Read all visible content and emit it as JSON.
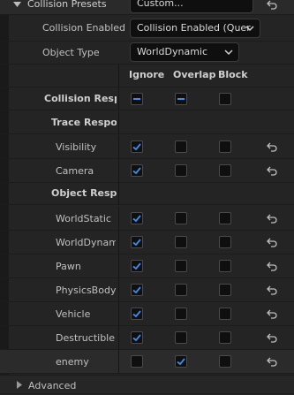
{
  "header": {
    "presets_label": "Collision Presets",
    "presets_value": "Custom...",
    "enabled_label": "Collision Enabled",
    "enabled_value": "Collision Enabled (Quer",
    "object_type_label": "Object Type",
    "object_type_value": "WorldDynamic"
  },
  "columns": {
    "ignore": "Ignore",
    "overlap": "Overlap",
    "block": "Block"
  },
  "collision_responses_label": "Collision Respon",
  "trace_label": "Trace Respor",
  "object_label": "Object Respo",
  "trace_rows": [
    {
      "label": "Visibility",
      "state": "ignore"
    },
    {
      "label": "Camera",
      "state": "ignore"
    }
  ],
  "object_rows": [
    {
      "label": "WorldStatic",
      "state": "ignore"
    },
    {
      "label": "WorldDynamic",
      "state": "ignore"
    },
    {
      "label": "Pawn",
      "state": "ignore"
    },
    {
      "label": "PhysicsBody",
      "state": "ignore"
    },
    {
      "label": "Vehicle",
      "state": "ignore"
    },
    {
      "label": "Destructible",
      "state": "ignore"
    },
    {
      "label": "enemy",
      "state": "overlap"
    }
  ],
  "advanced_label": "Advanced",
  "colors": {
    "accent": "#3b8ef0",
    "bg": "#242424"
  }
}
